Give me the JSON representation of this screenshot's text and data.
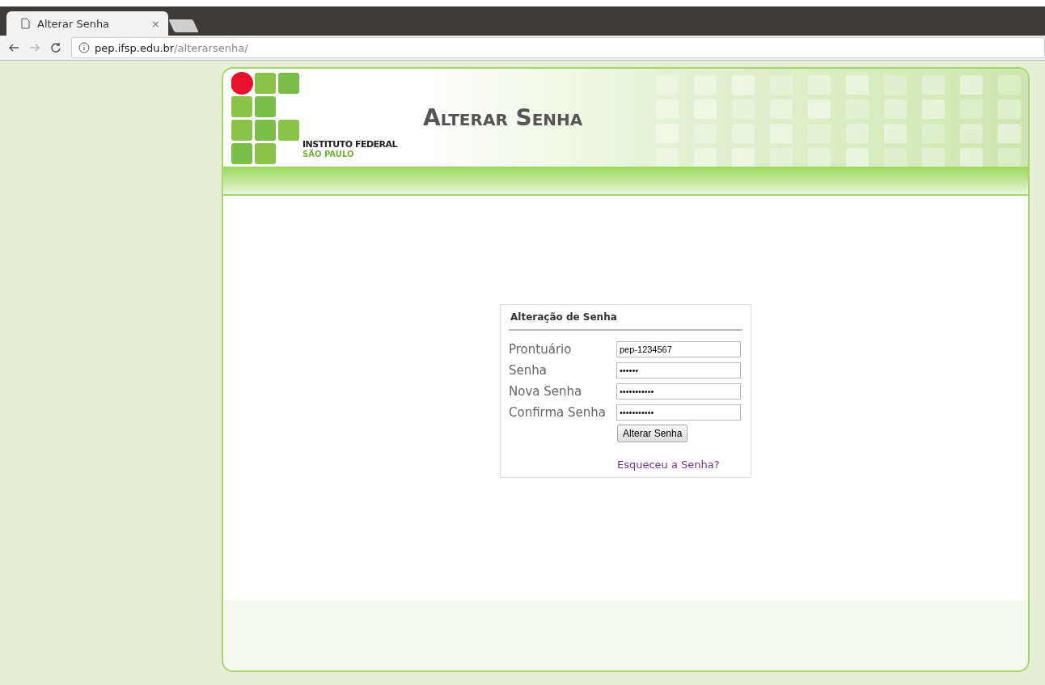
{
  "browser": {
    "tab_title": "Alterar Senha",
    "tab_close": "×",
    "url_host": "pep.ifsp.edu.br",
    "url_path": "/alterarsenha/"
  },
  "header": {
    "logo_line1": "INSTITUTO FEDERAL",
    "logo_line2": "SÃO PAULO",
    "title": "Alterar Senha"
  },
  "form": {
    "title": "Alteração de Senha",
    "fields": [
      {
        "label": "Prontuário",
        "value": "pep-1234567"
      },
      {
        "label": "Senha",
        "value": "••••••"
      },
      {
        "label": "Nova Senha",
        "value": "•••••••••••"
      },
      {
        "label": "Confirma Senha",
        "value": "•••••••••••"
      }
    ],
    "submit": "Alterar Senha",
    "forgot_link": "Esqueceu a Senha?"
  }
}
